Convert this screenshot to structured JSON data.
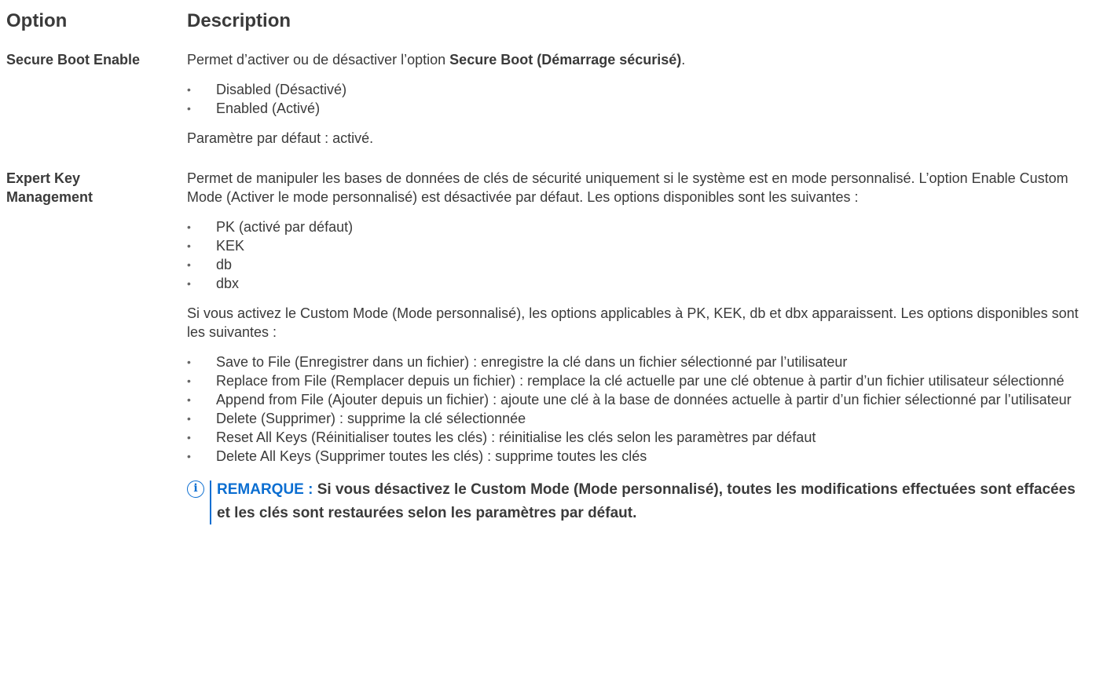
{
  "table": {
    "headers": {
      "option": "Option",
      "description": "Description"
    },
    "rows": [
      {
        "option": "Secure Boot Enable",
        "intro_prefix": "Permet d’activer ou de désactiver l’option ",
        "intro_bold": "Secure Boot (Démarrage sécurisé)",
        "intro_suffix": ".",
        "items": [
          "Disabled (Désactivé)",
          "Enabled (Activé)"
        ],
        "default": "Paramètre par défaut : activé."
      },
      {
        "option": "Expert Key Management",
        "intro": "Permet de manipuler les bases de données de clés de sécurité uniquement si le système est en mode personnalisé. L’option Enable Custom Mode (Activer le mode personnalisé) est désactivée par défaut. Les options disponibles sont les suivantes :",
        "items": [
          "PK (activé par défaut)",
          "KEK",
          "db",
          "dbx"
        ],
        "custom_intro": "Si vous activez le Custom Mode (Mode personnalisé), les options applicables à PK, KEK, db et dbx apparaissent. Les options disponibles sont les suivantes :",
        "custom_items": [
          "Save to File (Enregistrer dans un fichier) : enregistre la clé dans un fichier sélectionné par l’utilisateur",
          "Replace from File (Remplacer depuis un fichier) : remplace la clé actuelle par une clé obtenue à partir d’un fichier utilisateur sélectionné",
          "Append from File (Ajouter depuis un fichier) : ajoute une clé à la base de données actuelle à partir d’un fichier sélectionné par l’utilisateur",
          "Delete (Supprimer) : supprime la clé sélectionnée",
          "Reset All Keys (Réinitialiser toutes les clés) : réinitialise les clés selon les paramètres par défaut",
          "Delete All Keys (Supprimer toutes les clés) : supprime toutes les clés"
        ],
        "note": {
          "label": "REMARQUE :",
          "text": " Si vous désactivez le Custom Mode (Mode personnalisé), toutes les modifications effectuées sont effacées et les clés sont restaurées selon les paramètres par défaut."
        }
      }
    ]
  },
  "icons": {
    "note": "info-icon"
  },
  "colors": {
    "note_accent": "#0b6ed1",
    "text": "#3a3a3a"
  }
}
